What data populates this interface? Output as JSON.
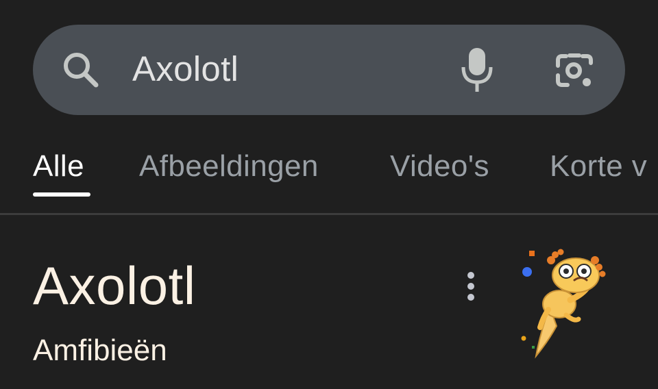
{
  "search": {
    "query": "Axolotl",
    "icons": {
      "left": "search-icon",
      "voice": "microphone-icon",
      "lens": "camera-lens-icon"
    }
  },
  "tabs": [
    {
      "label": "Alle",
      "active": true
    },
    {
      "label": "Afbeeldingen",
      "active": false
    },
    {
      "label": "Video's",
      "active": false
    },
    {
      "label": "Korte v",
      "active": false
    }
  ],
  "knowledge_panel": {
    "title": "Axolotl",
    "subtitle": "Amfibieën",
    "more_icon": "more-vert-icon",
    "image": "axolotl-illustration"
  },
  "colors": {
    "background": "#1f1f1f",
    "search_bar": "#4a4f55",
    "active_tab": "#ffffff",
    "inactive_tab": "#9aa0a6",
    "title_text": "#fbf1e4"
  }
}
